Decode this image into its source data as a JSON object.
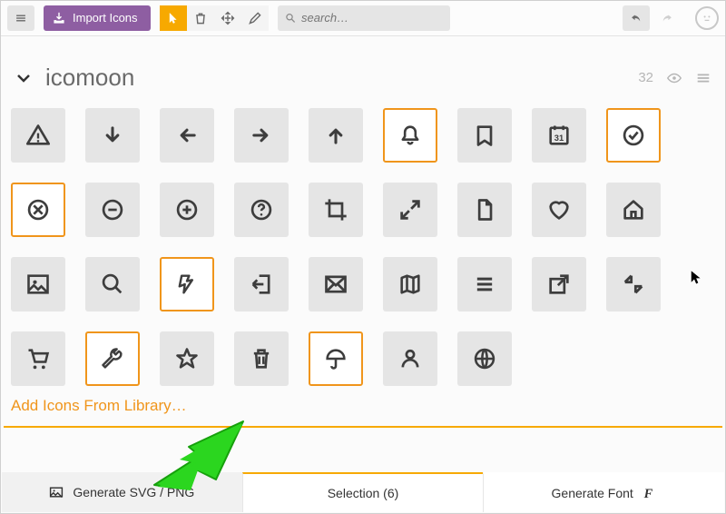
{
  "toolbar": {
    "import_label": "Import Icons",
    "search_placeholder": "search…"
  },
  "set": {
    "title": "icomoon",
    "count": "32"
  },
  "library_link": "Add Icons From Library…",
  "footer": {
    "generate_svg": "Generate SVG / PNG",
    "selection": "Selection (6)",
    "generate_font": "Generate Font"
  },
  "icons": [
    {
      "name": "alert-triangle",
      "selected": false
    },
    {
      "name": "arrow-down",
      "selected": false
    },
    {
      "name": "arrow-left",
      "selected": false
    },
    {
      "name": "arrow-right",
      "selected": false
    },
    {
      "name": "arrow-up",
      "selected": false
    },
    {
      "name": "bell",
      "selected": true
    },
    {
      "name": "bookmark",
      "selected": false
    },
    {
      "name": "calendar-date",
      "selected": false
    },
    {
      "name": "check-circle",
      "selected": true
    },
    {
      "name": "cancel-circle",
      "selected": true
    },
    {
      "name": "minus-circle",
      "selected": false
    },
    {
      "name": "plus-circle",
      "selected": false
    },
    {
      "name": "help-circle",
      "selected": false
    },
    {
      "name": "crop",
      "selected": false
    },
    {
      "name": "expand",
      "selected": false
    },
    {
      "name": "file",
      "selected": false
    },
    {
      "name": "heart",
      "selected": false
    },
    {
      "name": "home",
      "selected": false
    },
    {
      "name": "image",
      "selected": false
    },
    {
      "name": "search",
      "selected": false
    },
    {
      "name": "bolt",
      "selected": true
    },
    {
      "name": "logout",
      "selected": false
    },
    {
      "name": "mail",
      "selected": false
    },
    {
      "name": "map",
      "selected": false
    },
    {
      "name": "menu",
      "selected": false
    },
    {
      "name": "external-link",
      "selected": false
    },
    {
      "name": "contract",
      "selected": false
    },
    {
      "name": "cart",
      "selected": false
    },
    {
      "name": "wrench",
      "selected": true
    },
    {
      "name": "star",
      "selected": false
    },
    {
      "name": "trash",
      "selected": false
    },
    {
      "name": "umbrella",
      "selected": true
    },
    {
      "name": "user",
      "selected": false
    },
    {
      "name": "globe",
      "selected": false
    }
  ],
  "colors": {
    "purple": "#8e5ea2",
    "orange": "#f7a900",
    "accent_orange": "#f0951b"
  }
}
